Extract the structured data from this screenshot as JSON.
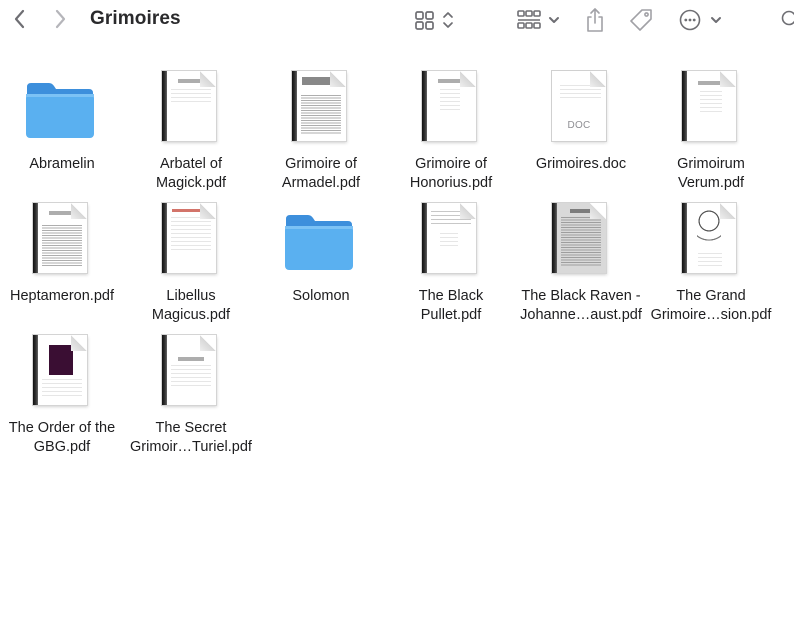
{
  "window": {
    "title": "Grimoires"
  },
  "toolbar": {
    "back_icon": "chevron-left-icon",
    "forward_icon": "chevron-right-icon",
    "view_icon": "icon-grid-view-icon",
    "group_icon": "group-by-icon",
    "share_icon": "share-icon",
    "tag_icon": "tag-icon",
    "more_icon": "more-ellipsis-icon",
    "search_icon": "search-icon"
  },
  "colors": {
    "folder_blue": "#5ab0f0",
    "folder_tab": "#3d8fdc"
  },
  "items": [
    {
      "name": "Abramelin",
      "kind": "folder"
    },
    {
      "name": "Arbatel of\nMagick.pdf",
      "kind": "pdf"
    },
    {
      "name": "Grimoire of\nArmadel.pdf",
      "kind": "pdf"
    },
    {
      "name": "Grimoire of\nHonorius.pdf",
      "kind": "pdf"
    },
    {
      "name": "Grimoires.doc",
      "kind": "doc",
      "badge": "DOC"
    },
    {
      "name": "Grimoirum\nVerum.pdf",
      "kind": "pdf"
    },
    {
      "name": "Heptameron.pdf",
      "kind": "pdf"
    },
    {
      "name": "Libellus\nMagicus.pdf",
      "kind": "pdf"
    },
    {
      "name": "Solomon",
      "kind": "folder"
    },
    {
      "name": "The Black\nPullet.pdf",
      "kind": "pdf"
    },
    {
      "name": "The Black Raven -\nJohanne…aust.pdf",
      "kind": "pdf"
    },
    {
      "name": "The Grand\nGrimoire…sion.pdf",
      "kind": "pdf"
    },
    {
      "name": "The Order of the\nGBG.pdf",
      "kind": "pdf"
    },
    {
      "name": "The Secret\nGrimoir…Turiel.pdf",
      "kind": "pdf"
    }
  ]
}
